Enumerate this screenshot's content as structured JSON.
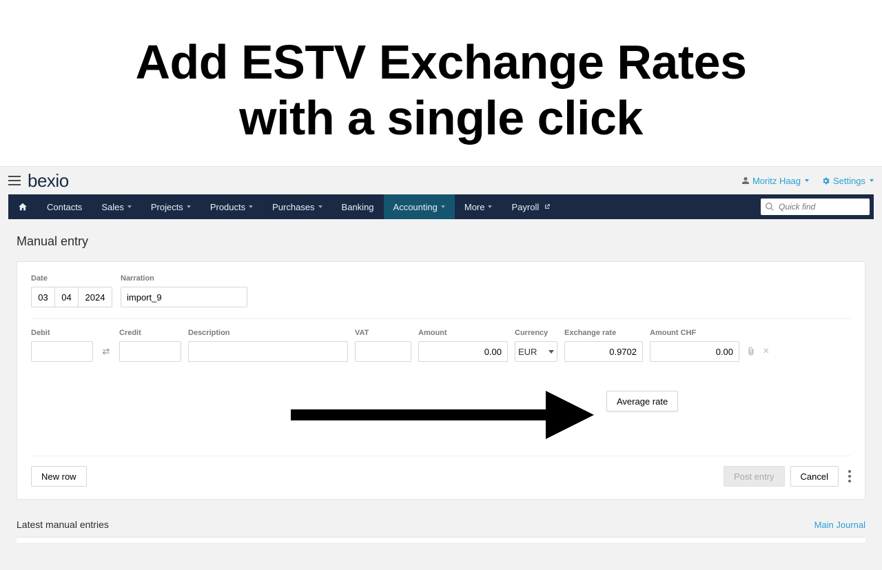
{
  "hero": {
    "line1": "Add ESTV Exchange Rates",
    "line2": "with a single click"
  },
  "topbar": {
    "brand": "bexio",
    "user_name": "Moritz Haag",
    "settings_label": "Settings"
  },
  "nav": {
    "contacts": "Contacts",
    "sales": "Sales",
    "projects": "Projects",
    "products": "Products",
    "purchases": "Purchases",
    "banking": "Banking",
    "accounting": "Accounting",
    "more": "More",
    "payroll": "Payroll",
    "search_placeholder": "Quick find"
  },
  "page": {
    "title": "Manual entry",
    "labels": {
      "date": "Date",
      "narration": "Narration",
      "debit": "Debit",
      "credit": "Credit",
      "description": "Description",
      "vat": "VAT",
      "amount": "Amount",
      "currency": "Currency",
      "exchange_rate": "Exchange rate",
      "amount_chf": "Amount CHF"
    },
    "values": {
      "date_day": "03",
      "date_month": "04",
      "date_year": "2024",
      "narration": "import_9",
      "debit": "",
      "credit": "",
      "description": "",
      "vat": "",
      "amount": "0.00",
      "currency": "EUR",
      "exchange_rate": "0.9702",
      "amount_chf": "0.00"
    },
    "buttons": {
      "average_rate": "Average rate",
      "new_row": "New row",
      "post_entry": "Post entry",
      "cancel": "Cancel"
    },
    "latest_heading": "Latest manual entries",
    "main_journal": "Main Journal"
  }
}
